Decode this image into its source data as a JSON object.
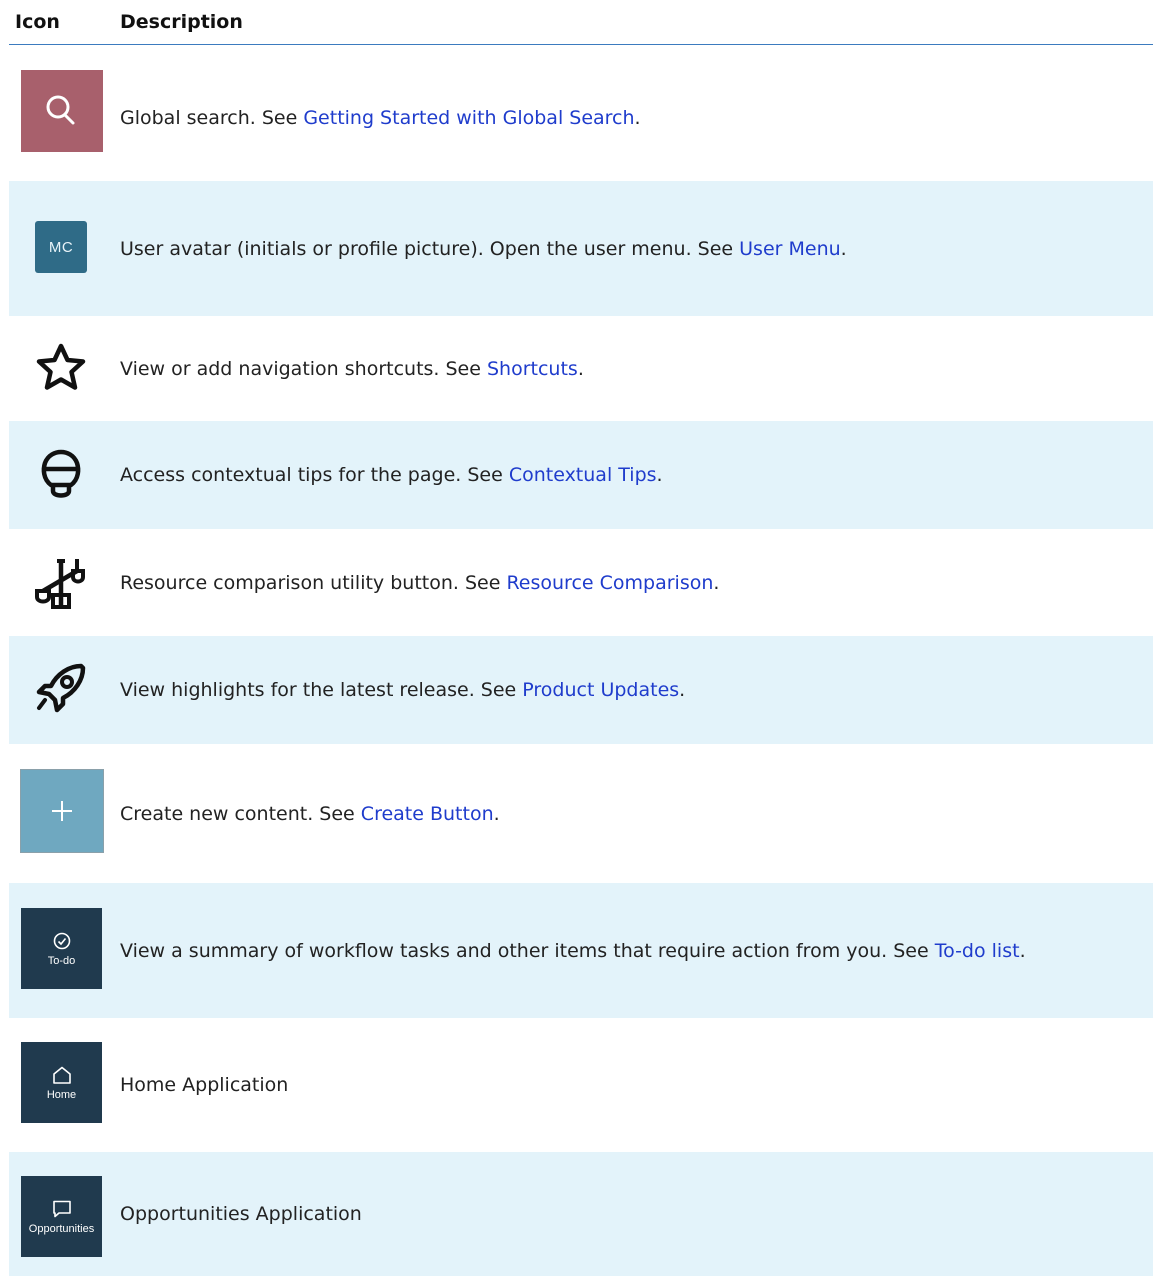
{
  "header": {
    "icon_col": "Icon",
    "desc_col": "Description"
  },
  "rows": [
    {
      "icon": "search-icon",
      "text": "Global search. See ",
      "link": "Getting Started with Global Search",
      "suffix": "."
    },
    {
      "icon": "avatar-icon",
      "avatar_initials": "MC",
      "text": "User avatar (initials or profile picture). Open the user menu. See ",
      "link": "User Menu",
      "suffix": "."
    },
    {
      "icon": "star-icon",
      "text": "View or add navigation shortcuts. See ",
      "link": "Shortcuts",
      "suffix": "."
    },
    {
      "icon": "lightbulb-icon",
      "text": "Access contextual tips for the page. See ",
      "link": "Contextual Tips",
      "suffix": "."
    },
    {
      "icon": "balance-scale-icon",
      "text": "Resource comparison utility button. See ",
      "link": "Resource Comparison",
      "suffix": "."
    },
    {
      "icon": "rocket-icon",
      "text": "View highlights for the latest release. See ",
      "link": "Product Updates",
      "suffix": "."
    },
    {
      "icon": "plus-icon",
      "text": "Create new content. See ",
      "link": "Create Button",
      "suffix": "."
    },
    {
      "icon": "check-circle-icon",
      "tile_label": "To-do",
      "text": "View a summary of workflow tasks and other items that require action from you. See ",
      "link": "To-do list",
      "suffix": "."
    },
    {
      "icon": "home-icon",
      "tile_label": "Home",
      "text": "Home Application"
    },
    {
      "icon": "chat-bubble-icon",
      "tile_label": "Opportunities",
      "text": "Opportunities Application"
    }
  ],
  "colors": {
    "link": "#1f3ccc",
    "alt_row": "#e3f3fa",
    "header_rule": "#3b7bbf",
    "search_tile": "#a8606c",
    "avatar_tile": "#2f6b87",
    "create_tile": "#6fa8c0",
    "dark_tile": "#203a4e"
  }
}
